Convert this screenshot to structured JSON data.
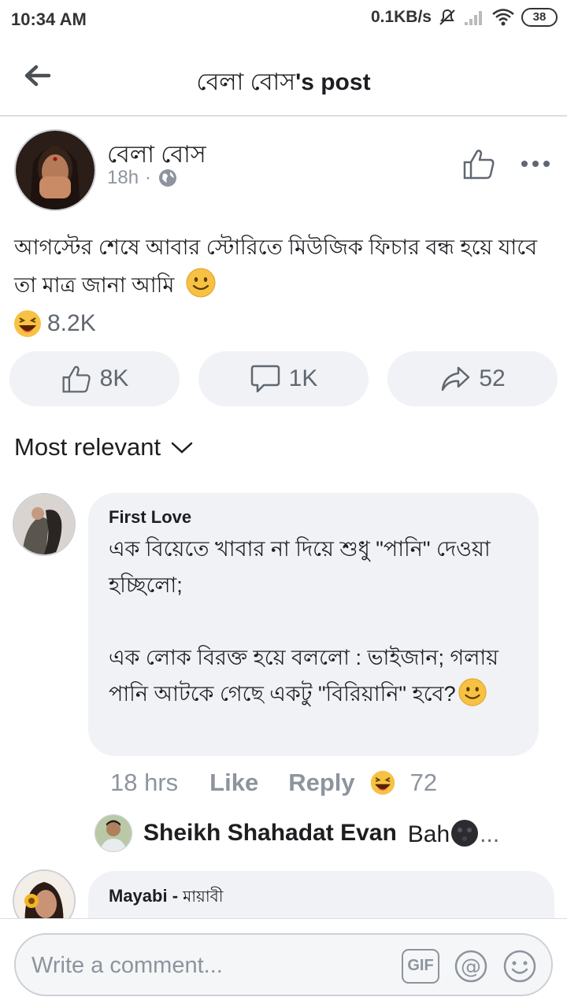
{
  "status_bar": {
    "time": "10:34 AM",
    "network_speed": "0.1KB/s",
    "battery": "38"
  },
  "header": {
    "title_name": "বেলা বোস",
    "title_suffix": "'s post"
  },
  "post": {
    "author": "বেলা বোস",
    "time": "18h",
    "separator": "·",
    "text": "আগস্টের শেষে আবার স্টোরিতে মিউজিক ফিচার বন্ধ হয়ে যাবে তা মাত্র জানা আমি",
    "text_emoji": "slightly-smiling-emoji",
    "reaction_count": "8.2K",
    "actions": {
      "likes": "8K",
      "comments": "1K",
      "shares": "52"
    }
  },
  "sort": {
    "label": "Most relevant"
  },
  "comments": [
    {
      "author": "First Love",
      "text": "এক বিয়েতে খাবার না দিয়ে শুধু \"পানি\" দেওয়া হচ্ছিলো;\n\nএক লোক বিরক্ত হয়ে বললো : ভাইজান; গলায় পানি আটকে গেছে একটু \"বিরিয়ানি\" হবে?",
      "time": "18 hrs",
      "like_label": "Like",
      "reply_label": "Reply",
      "reaction_count": "72",
      "reply": {
        "author": "Sheikh Shahadat Evan",
        "text": "Bah",
        "ellipsis": "..."
      }
    },
    {
      "author": "Mayabi - ",
      "author_bn": "মায়াবী"
    }
  ],
  "composer": {
    "placeholder": "Write a comment...",
    "gif_label": "GIF"
  },
  "colors": {
    "bubble": "#f0f2f5",
    "meta": "#8d949e",
    "emoji": "#f7c143"
  }
}
